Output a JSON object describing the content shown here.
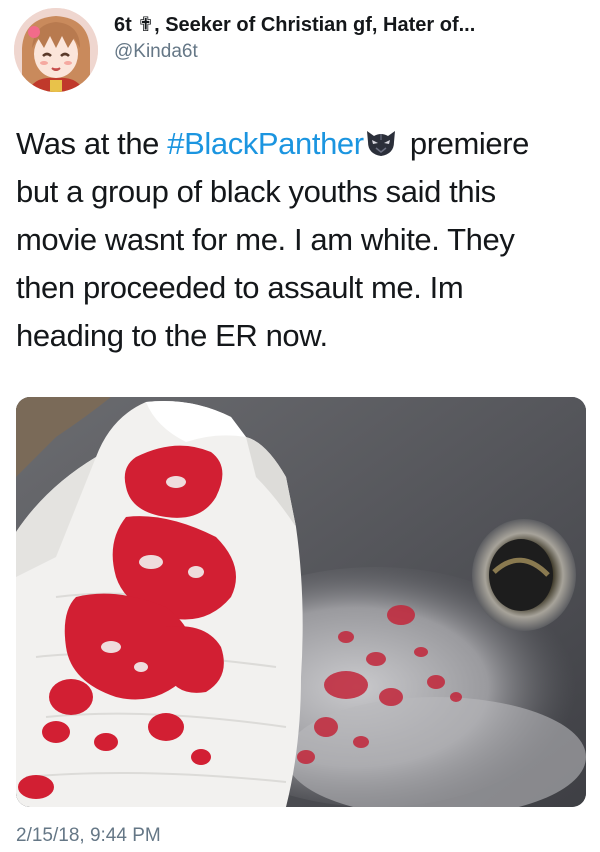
{
  "tweet": {
    "author": {
      "display_name": "6t ✟, Seeker of Christian gf, Hater of...",
      "handle": "@Kinda6t",
      "avatar_icon": "anime-avatar-icon"
    },
    "text": {
      "line1_pre": "Was at the ",
      "line1_hashtag": "#BlackPanther",
      "line1_emoji": "black-panther-mask-emoji",
      "line1_post": " premiere",
      "line2": "but a group of black youths said this",
      "line3": "movie wasnt for me. I am white. They",
      "line4": "then proceeded to assault me. Im",
      "line5": "heading to the ER now."
    },
    "media": {
      "image_icon": "bloody-tissue-in-sink-photo"
    },
    "timestamp": "2/15/18, 9:44 PM"
  },
  "colors": {
    "hashtag": "#1b95e0",
    "text": "#14171a",
    "secondary": "#657786"
  }
}
